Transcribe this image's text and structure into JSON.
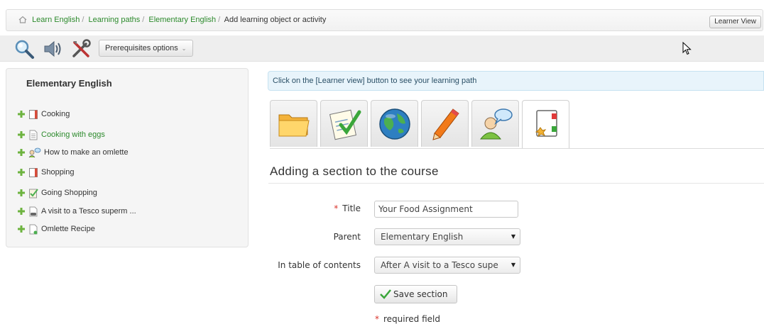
{
  "breadcrumb": {
    "items": [
      "Learn English",
      "Learning paths",
      "Elementary English"
    ],
    "separator": "/",
    "current": "Add learning object or activity"
  },
  "header": {
    "learner_view_label": "Learner View"
  },
  "toolbar": {
    "icons": [
      "search-icon",
      "audio-icon",
      "tools-icon"
    ],
    "prereq_label": "Prerequisites options",
    "prereq_caret": "⌄"
  },
  "sidebar": {
    "title": "Elementary English",
    "items": [
      {
        "label": "Cooking",
        "icon": "chapter-icon"
      },
      {
        "label": "Cooking with eggs",
        "icon": "document-icon",
        "active": true
      },
      {
        "label": "How to make an omlette",
        "icon": "forum-icon"
      },
      {
        "label": "Shopping",
        "icon": "chapter-icon"
      },
      {
        "label": "Going Shopping",
        "icon": "quiz-icon"
      },
      {
        "label": "A visit to a Tesco superm ...",
        "icon": "link-icon"
      },
      {
        "label": "Omlette Recipe",
        "icon": "page-icon"
      }
    ]
  },
  "info_message": "Click on the [Learner view] button to see your learning path",
  "tabs": [
    {
      "icon": "folder-icon"
    },
    {
      "icon": "assignment-icon"
    },
    {
      "icon": "globe-icon"
    },
    {
      "icon": "pencil-icon"
    },
    {
      "icon": "user-chat-icon"
    },
    {
      "icon": "section-icon",
      "active": true
    }
  ],
  "form": {
    "heading": "Adding a section to the course",
    "title_label": "Title",
    "title_value": "Your Food Assignment",
    "parent_label": "Parent",
    "parent_value": "Elementary English",
    "toc_label": "In table of contents",
    "toc_value": "After A visit to a Tesco supe",
    "required_star": "*",
    "save_label": "Save section",
    "required_note": "required field"
  },
  "colors": {
    "link": "#2c8a2c",
    "info_bg": "#e8f4fb",
    "required": "#d9332b"
  }
}
